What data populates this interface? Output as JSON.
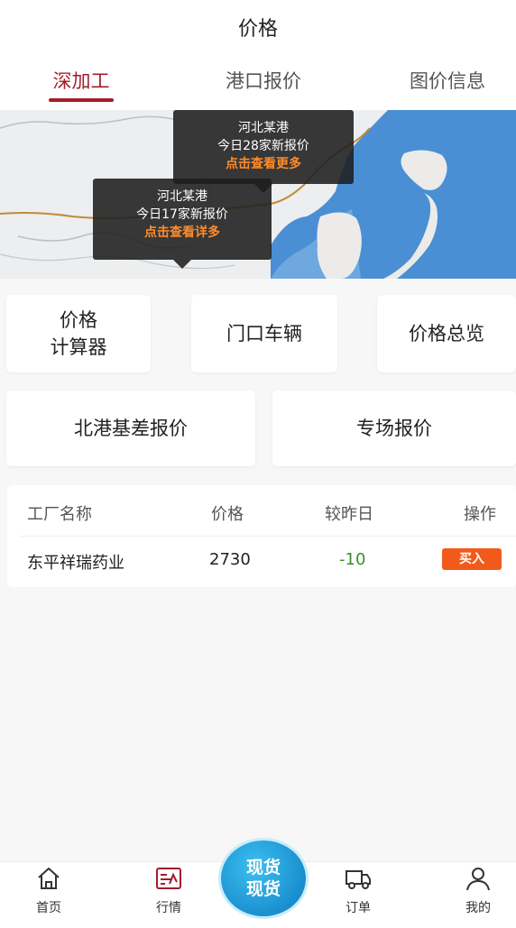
{
  "header": {
    "title": "价格",
    "tabs": [
      {
        "label": "深加工",
        "active": true
      },
      {
        "label": "港口报价",
        "active": false
      },
      {
        "label": "图价信息",
        "active": false
      }
    ]
  },
  "map": {
    "popups": [
      {
        "port": "河北某港",
        "count_text": "今日28家新报价",
        "link": "点击查看更多"
      },
      {
        "port": "河北某港",
        "count_text": "今日17家新报价",
        "link": "点击查看详多"
      }
    ]
  },
  "quick_actions": {
    "row1": [
      "价格计算器",
      "门口车辆",
      "价格总览"
    ],
    "calc_line1": "价格",
    "calc_line2": "计算器",
    "row2": [
      "北港基差报价",
      "专场报价"
    ]
  },
  "table": {
    "headers": [
      "工厂名称",
      "价格",
      "较昨日",
      "操作"
    ],
    "rows": [
      {
        "factory": "东平祥瑞药业",
        "price": "2730",
        "change": "-10",
        "action": "买入"
      }
    ]
  },
  "bottom_nav": {
    "items": [
      {
        "label": "首页",
        "icon": "home-icon"
      },
      {
        "label": "行情",
        "icon": "market-icon",
        "active": true
      },
      {
        "label": "订单",
        "icon": "truck-icon"
      },
      {
        "label": "我的",
        "icon": "user-icon"
      }
    ],
    "center_line1": "现货",
    "center_line2": "现货"
  },
  "colors": {
    "accent": "#a31d2a",
    "buy": "#f15a1a",
    "negative": "#3b8f2c",
    "popup_link": "#ff8c2a",
    "center_button": "#1a8fd0"
  }
}
